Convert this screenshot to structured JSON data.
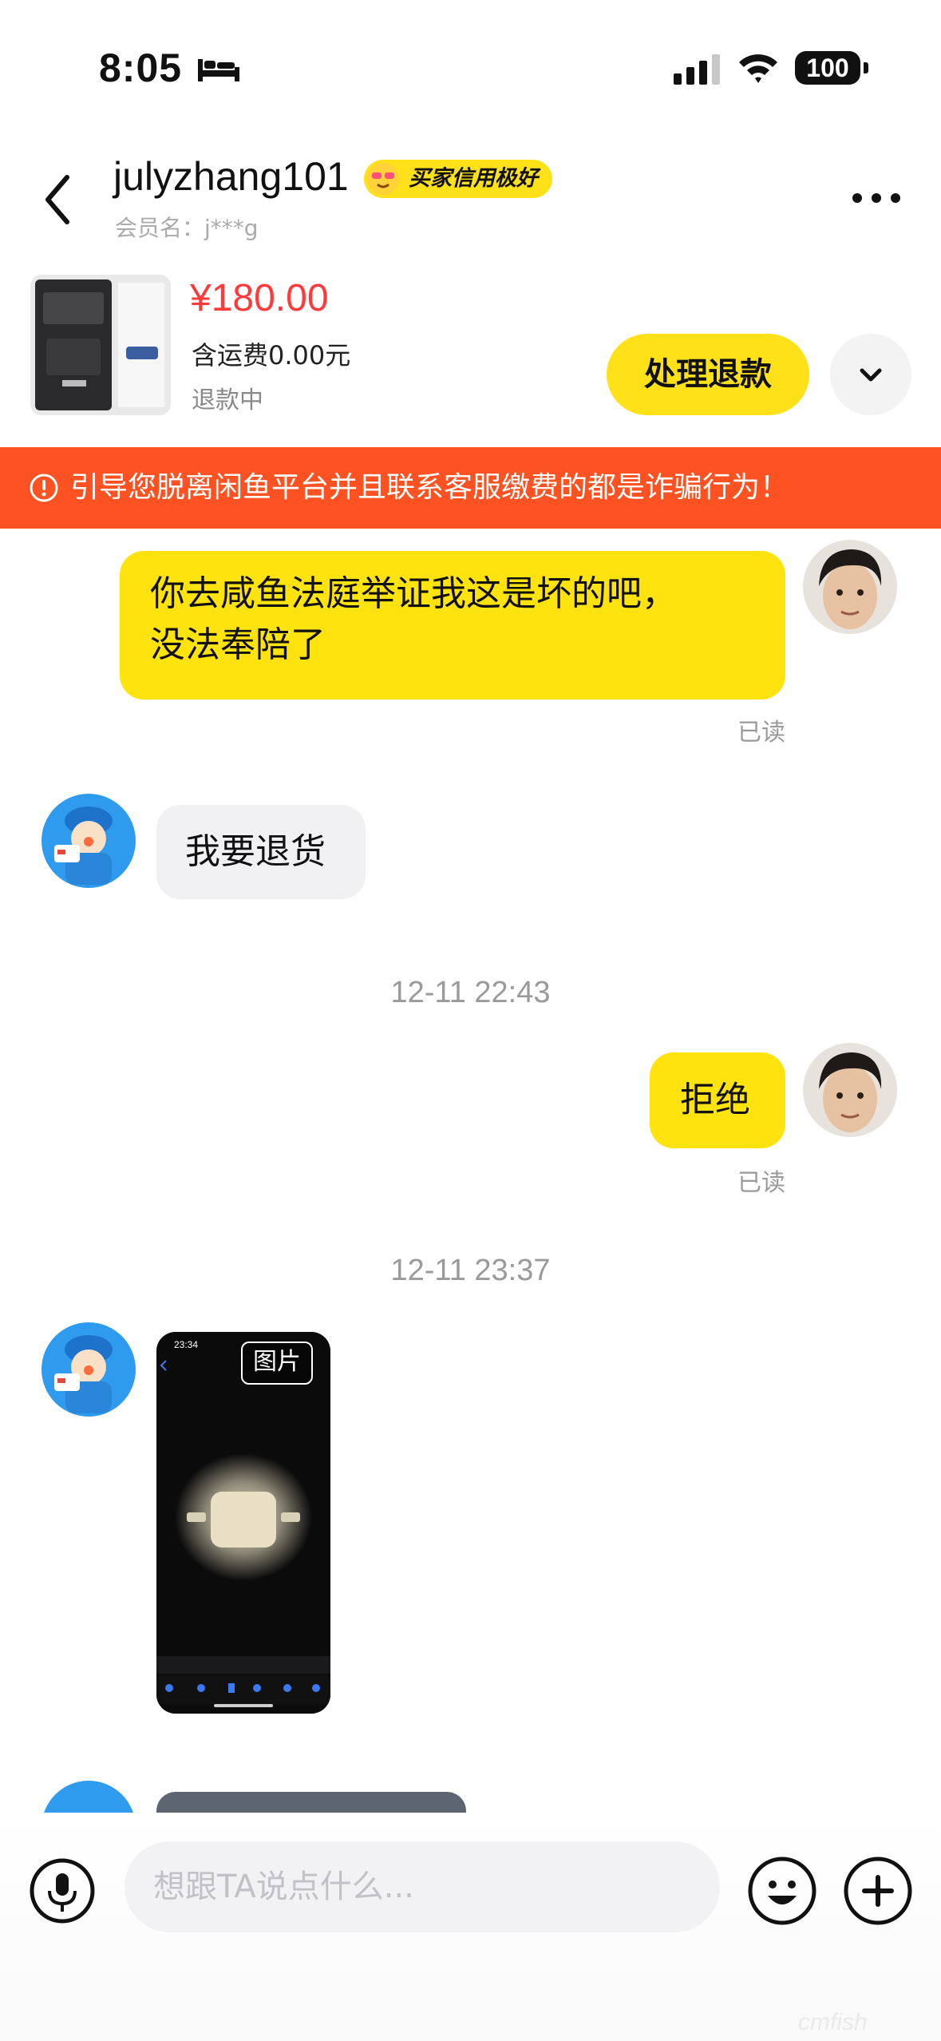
{
  "status_bar": {
    "time": "8:05",
    "battery": "100"
  },
  "header": {
    "title": "julyzhang101",
    "credit_badge": "买家信用极好",
    "subtitle": "会员名：j***g"
  },
  "product": {
    "price": "¥180.00",
    "shipping": "含运费0.00元",
    "status": "退款中",
    "action_label": "处理退款"
  },
  "warning": {
    "text": "引导您脱离闲鱼平台并且联系客服缴费的都是诈骗行为！"
  },
  "messages": {
    "m1": {
      "line1": "你去咸鱼法庭举证我这是坏的吧，",
      "line2": "没法奉陪了",
      "status": "已读"
    },
    "m2": {
      "text": "我要退货"
    },
    "ts1": "12-11 22:43",
    "m3": {
      "text": "拒绝",
      "status": "已读"
    },
    "ts2": "12-11 23:37",
    "m4": {
      "image_tag": "图片",
      "image_time": "23:34"
    }
  },
  "composer": {
    "placeholder": "想跟TA说点什么..."
  },
  "watermark": "cmfish"
}
